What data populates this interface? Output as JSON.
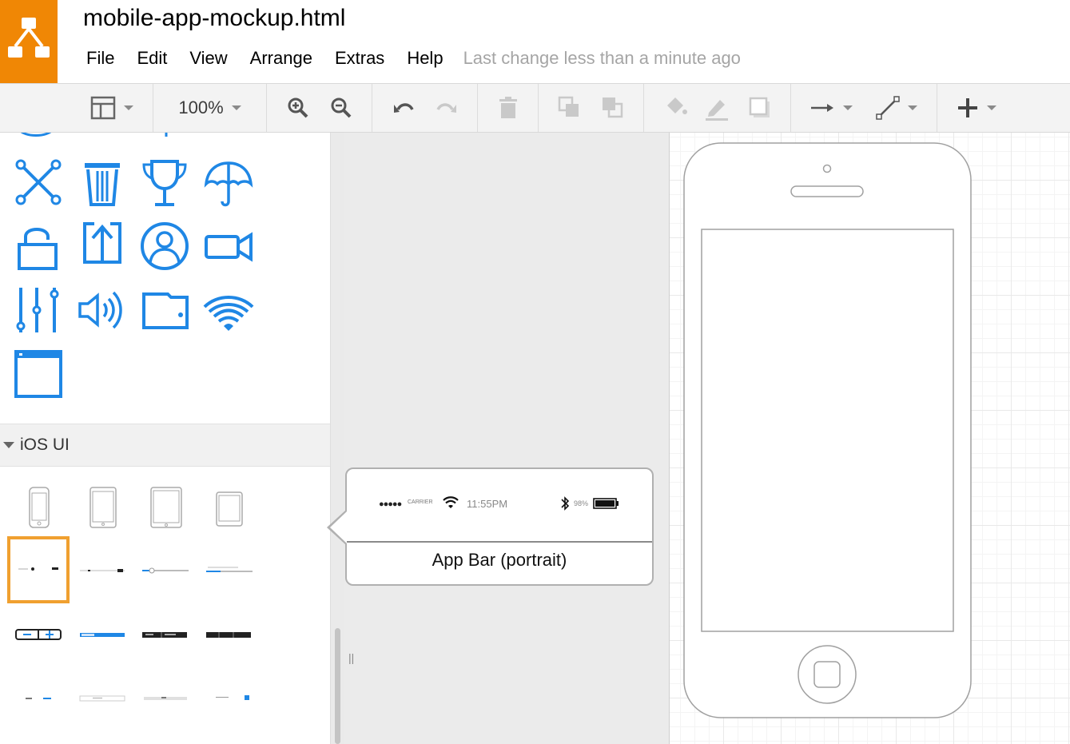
{
  "app": {
    "document_title": "mobile-app-mockup.html",
    "menu": [
      "File",
      "Edit",
      "View",
      "Arrange",
      "Extras",
      "Help"
    ],
    "last_change": "Last change less than a minute ago"
  },
  "toolbar": {
    "zoom": "100%"
  },
  "sidebar": {
    "sections": [
      {
        "name": "",
        "icons": [
          "scissors-icon",
          "trash-icon",
          "trophy-icon",
          "umbrella-icon",
          "unlock-icon",
          "upload-icon",
          "user-icon",
          "video-icon",
          "sliders-icon",
          "volume-icon",
          "wallet-icon",
          "wifi-icon",
          "window-icon"
        ]
      },
      {
        "name": "iOS UI",
        "expanded": true
      }
    ]
  },
  "tooltip": {
    "title": "App Bar (portrait)",
    "status_bar": {
      "dots": "●●●●●",
      "carrier": "CARRIER",
      "time": "11:55PM",
      "battery": "98%"
    }
  },
  "canvas": {
    "shape": "iphone-portrait"
  },
  "colors": {
    "accent": "#f08705",
    "icon_blue": "#1f87e5",
    "selection": "#f0a030"
  }
}
